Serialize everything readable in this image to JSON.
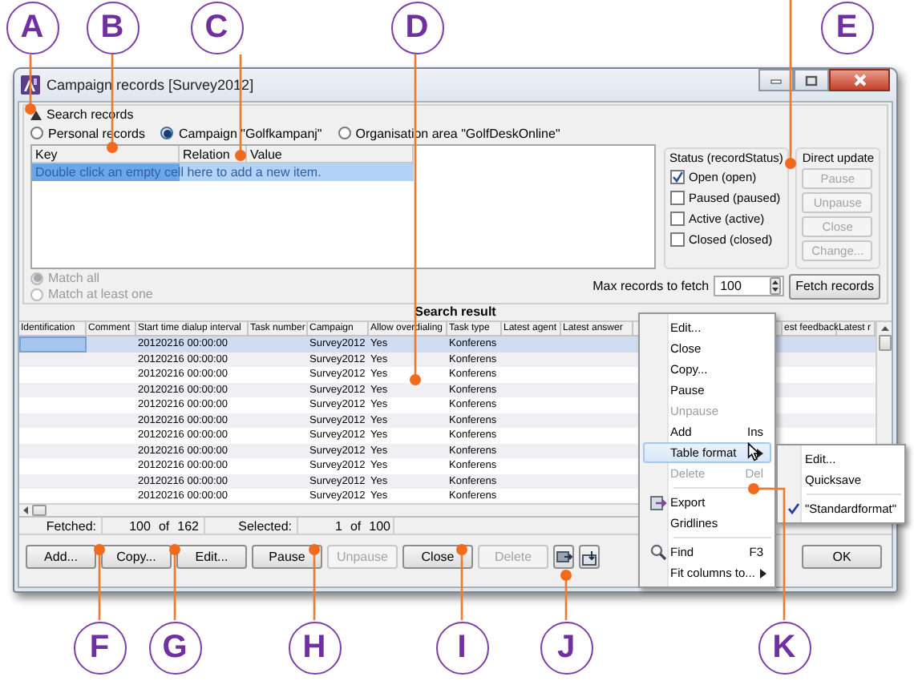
{
  "callouts": [
    {
      "letter": "A"
    },
    {
      "letter": "B"
    },
    {
      "letter": "C"
    },
    {
      "letter": "D"
    },
    {
      "letter": "E"
    },
    {
      "letter": "F"
    },
    {
      "letter": "G"
    },
    {
      "letter": "H"
    },
    {
      "letter": "I"
    },
    {
      "letter": "J"
    },
    {
      "letter": "K"
    }
  ],
  "window": {
    "title": "Campaign records [Survey2012]"
  },
  "search": {
    "title": "Search records",
    "expanded": true,
    "scopes": [
      {
        "label": "Personal records",
        "selected": false
      },
      {
        "label": "Campaign \"Golfkampanj\"",
        "selected": true
      },
      {
        "label": "Organisation area \"GolfDeskOnline\"",
        "selected": false
      }
    ],
    "criteria_columns": [
      "Key",
      "Relation",
      "Value"
    ],
    "criteria_hint": "Double click an empty cell here to add a new item.",
    "match": {
      "disabled": true,
      "options": [
        {
          "label": "Match all",
          "selected": true
        },
        {
          "label": "Match at least one",
          "selected": false
        }
      ]
    },
    "status": {
      "title": "Status (recordStatus)",
      "options": [
        {
          "label": "Open (open)",
          "checked": true
        },
        {
          "label": "Paused (paused)",
          "checked": false
        },
        {
          "label": "Active (active)",
          "checked": false
        },
        {
          "label": "Closed (closed)",
          "checked": false
        }
      ]
    },
    "direct_update": {
      "title": "Direct update",
      "buttons": [
        {
          "label": "Pause",
          "disabled": true
        },
        {
          "label": "Unpause",
          "disabled": true
        },
        {
          "label": "Close",
          "disabled": true
        },
        {
          "label": "Change...",
          "disabled": true
        }
      ]
    },
    "max_records": {
      "label": "Max records to fetch",
      "value": "100"
    },
    "fetch_button": "Fetch records"
  },
  "results": {
    "title": "Search result",
    "columns": [
      "Identification",
      "Comment",
      "Start time dialup interval",
      "Task number",
      "Campaign",
      "Allow overdialing",
      "Task type",
      "Latest agent",
      "Latest answer",
      "est feedback",
      "Latest r"
    ],
    "rows": [
      {
        "start_time": "20120216 00:00:00",
        "campaign": "Survey2012",
        "allow_overdialing": "Yes",
        "task_type": "Konferens",
        "selected": true
      },
      {
        "start_time": "20120216 00:00:00",
        "campaign": "Survey2012",
        "allow_overdialing": "Yes",
        "task_type": "Konferens",
        "selected": false
      },
      {
        "start_time": "20120216 00:00:00",
        "campaign": "Survey2012",
        "allow_overdialing": "Yes",
        "task_type": "Konferens",
        "selected": false
      },
      {
        "start_time": "20120216 00:00:00",
        "campaign": "Survey2012",
        "allow_overdialing": "Yes",
        "task_type": "Konferens",
        "selected": false
      },
      {
        "start_time": "20120216 00:00:00",
        "campaign": "Survey2012",
        "allow_overdialing": "Yes",
        "task_type": "Konferens",
        "selected": false
      },
      {
        "start_time": "20120216 00:00:00",
        "campaign": "Survey2012",
        "allow_overdialing": "Yes",
        "task_type": "Konferens",
        "selected": false
      },
      {
        "start_time": "20120216 00:00:00",
        "campaign": "Survey2012",
        "allow_overdialing": "Yes",
        "task_type": "Konferens",
        "selected": false
      },
      {
        "start_time": "20120216 00:00:00",
        "campaign": "Survey2012",
        "allow_overdialing": "Yes",
        "task_type": "Konferens",
        "selected": false
      },
      {
        "start_time": "20120216 00:00:00",
        "campaign": "Survey2012",
        "allow_overdialing": "Yes",
        "task_type": "Konferens",
        "selected": false
      },
      {
        "start_time": "20120216 00:00:00",
        "campaign": "Survey2012",
        "allow_overdialing": "Yes",
        "task_type": "Konferens",
        "selected": false
      },
      {
        "start_time": "20120216 00:00:00",
        "campaign": "Survey2012",
        "allow_overdialing": "Yes",
        "task_type": "Konferens",
        "selected": false
      }
    ]
  },
  "status_bar": {
    "fetched_label": "Fetched:",
    "fetched": "100",
    "fetched_of": "of",
    "fetched_total": "162",
    "selected_label": "Selected:",
    "selected": "1",
    "selected_of": "of",
    "selected_total": "100"
  },
  "buttons": [
    {
      "label": "Add...",
      "disabled": false
    },
    {
      "label": "Copy...",
      "disabled": false
    },
    {
      "label": "Edit...",
      "disabled": false
    },
    {
      "label": "Pause",
      "disabled": false
    },
    {
      "label": "Unpause",
      "disabled": true
    },
    {
      "label": "Close",
      "disabled": false
    },
    {
      "label": "Delete",
      "disabled": true
    }
  ],
  "ok_button": "OK",
  "context_menu": {
    "items": [
      {
        "kind": "item",
        "label": "Edit...",
        "disabled": false,
        "highlighted": false,
        "submenu": false
      },
      {
        "kind": "item",
        "label": "Close",
        "disabled": false,
        "highlighted": false,
        "submenu": false
      },
      {
        "kind": "item",
        "label": "Copy...",
        "disabled": false,
        "highlighted": false,
        "submenu": false
      },
      {
        "kind": "item",
        "label": "Pause",
        "disabled": false,
        "highlighted": false,
        "submenu": false
      },
      {
        "kind": "item",
        "label": "Unpause",
        "disabled": true,
        "highlighted": false,
        "submenu": false
      },
      {
        "kind": "item",
        "label": "Add",
        "shortcut": "Ins",
        "disabled": false,
        "highlighted": false,
        "submenu": false
      },
      {
        "kind": "item",
        "label": "Table format",
        "disabled": false,
        "highlighted": true,
        "submenu": true
      },
      {
        "kind": "item",
        "label": "Delete",
        "shortcut": "Del",
        "disabled": true,
        "highlighted": false,
        "submenu": false
      },
      {
        "kind": "separator"
      },
      {
        "kind": "item",
        "label": "Export",
        "disabled": false,
        "highlighted": false,
        "submenu": false
      },
      {
        "kind": "item",
        "label": "Gridlines",
        "disabled": false,
        "highlighted": false,
        "submenu": false
      },
      {
        "kind": "separator"
      },
      {
        "kind": "item",
        "label": "Find",
        "shortcut": "F3",
        "disabled": false,
        "highlighted": false,
        "submenu": false
      },
      {
        "kind": "item",
        "label": "Fit columns to...",
        "disabled": false,
        "highlighted": false,
        "submenu": true
      }
    ],
    "submenu": {
      "items": [
        {
          "kind": "item",
          "label": "Edit...",
          "checked": false
        },
        {
          "kind": "item",
          "label": "Quicksave",
          "checked": false
        },
        {
          "kind": "separator"
        },
        {
          "kind": "item",
          "label": "\"Standardformat\"",
          "checked": true
        }
      ]
    }
  }
}
